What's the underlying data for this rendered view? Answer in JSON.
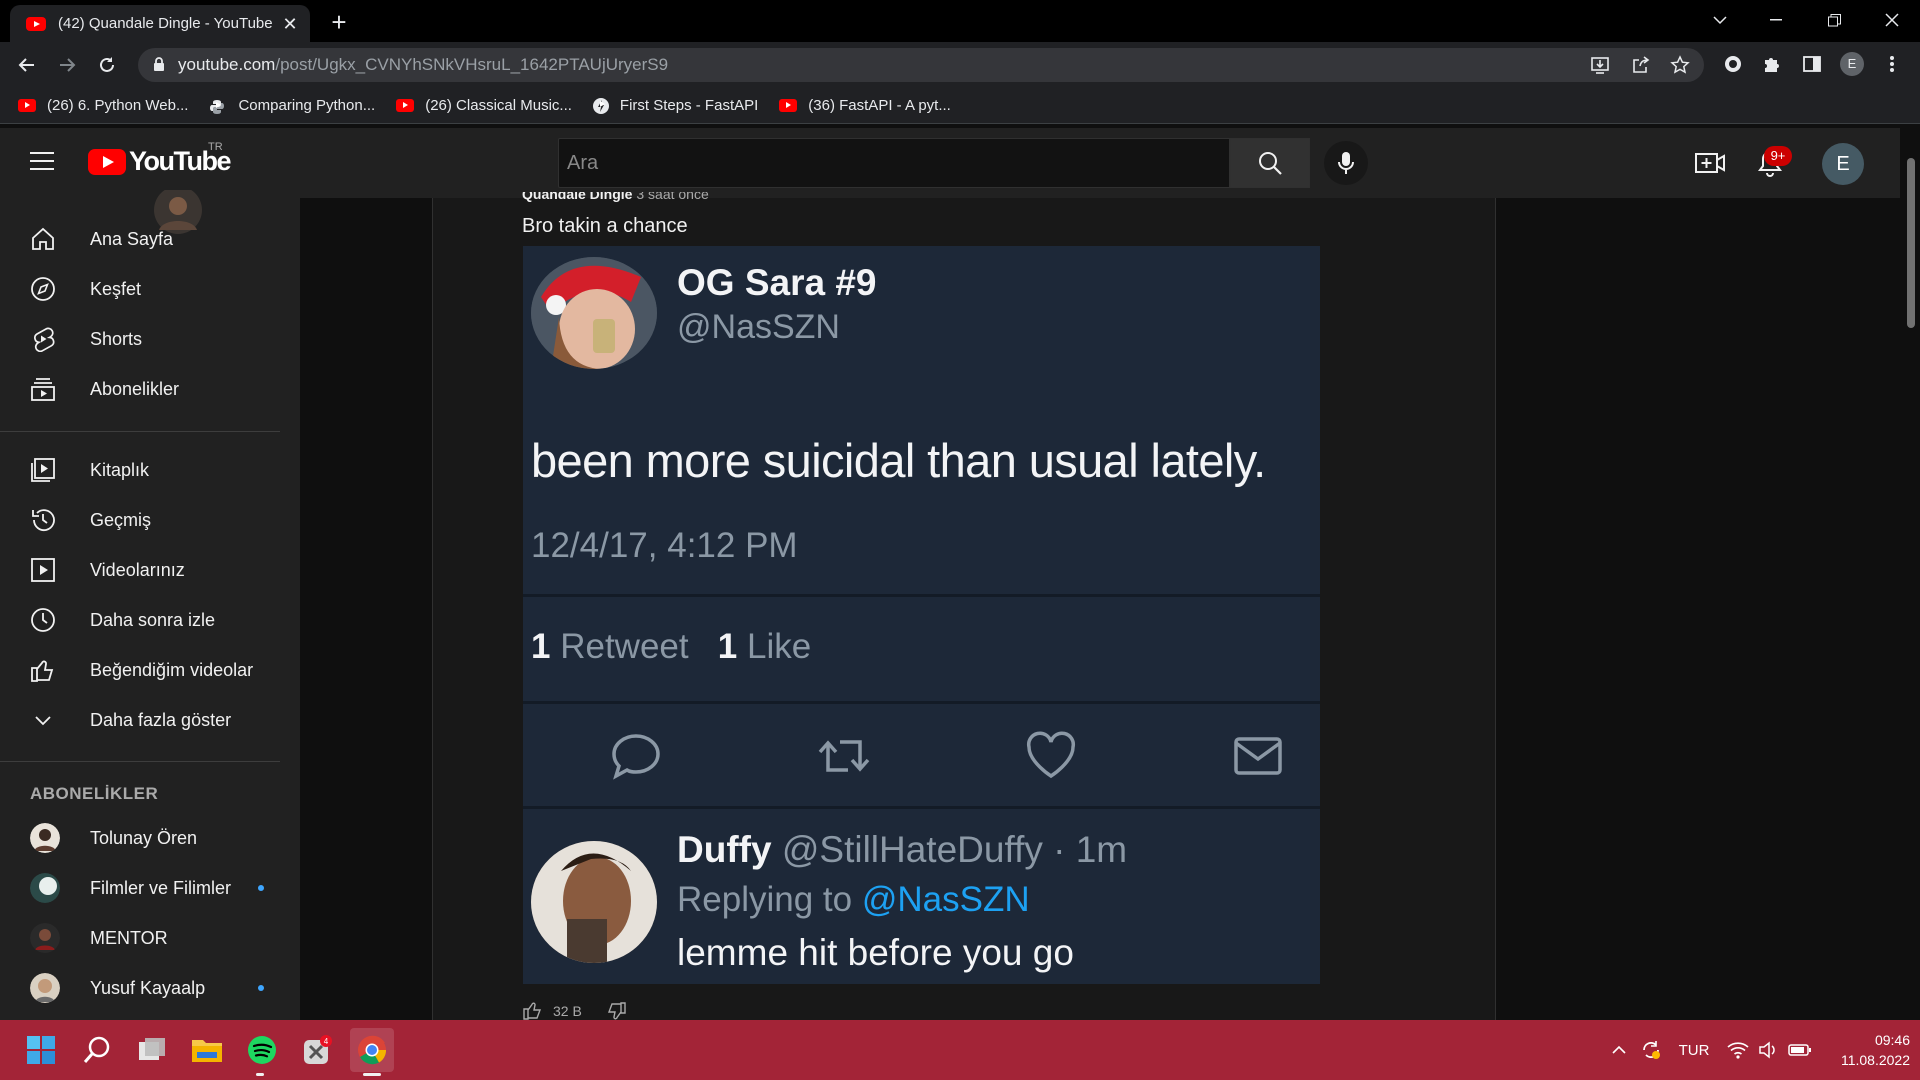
{
  "browser": {
    "tab_title": "(42) Quandale Dingle - YouTube",
    "url_host": "youtube.com",
    "url_path": "/post/Ugkx_CVNYhSNkVHsruL_1642PTAUjUryerS9",
    "profile_initial": "E",
    "bookmarks": [
      {
        "label": "(26) 6. Python Web...",
        "icon": "youtube-icon"
      },
      {
        "label": "Comparing Python...",
        "icon": "python-icon"
      },
      {
        "label": "(26) Classical Music...",
        "icon": "youtube-icon"
      },
      {
        "label": "First Steps - FastAPI",
        "icon": "fastapi-icon"
      },
      {
        "label": "(36) FastAPI - A pyt...",
        "icon": "youtube-icon"
      }
    ]
  },
  "youtube": {
    "logo_text": "YouTube",
    "region": "TR",
    "search_placeholder": "Ara",
    "notification_count": "9+",
    "avatar_initial": "E"
  },
  "sidebar": {
    "primary": [
      {
        "label": "Ana Sayfa",
        "icon": "home-icon"
      },
      {
        "label": "Keşfet",
        "icon": "explore-icon"
      },
      {
        "label": "Shorts",
        "icon": "shorts-icon"
      },
      {
        "label": "Abonelikler",
        "icon": "subscriptions-icon"
      }
    ],
    "library": [
      {
        "label": "Kitaplık",
        "icon": "library-icon"
      },
      {
        "label": "Geçmiş",
        "icon": "history-icon"
      },
      {
        "label": "Videolarınız",
        "icon": "your-videos-icon"
      },
      {
        "label": "Daha sonra izle",
        "icon": "watch-later-icon"
      },
      {
        "label": "Beğendiğim videolar",
        "icon": "liked-icon"
      },
      {
        "label": "Daha fazla göster",
        "icon": "chevron-down-icon"
      }
    ],
    "subscriptions_heading": "ABONELİKLER",
    "subscriptions": [
      {
        "label": "Tolunay Ören",
        "new": false
      },
      {
        "label": "Filmler ve Filimler",
        "new": true
      },
      {
        "label": "MENTOR",
        "new": false
      },
      {
        "label": "Yusuf Kayaalp",
        "new": true
      }
    ]
  },
  "post": {
    "author": "Quandale Dingle",
    "time": "3 saat önce",
    "text": "Bro takin a chance",
    "likes": "32 B",
    "tweet": {
      "name": "OG Sara #9",
      "handle": "@NasSZN",
      "body": "been more suicidal than usual lately.",
      "date": "12/4/17, 4:12 PM",
      "retweets_count": "1",
      "retweets_label": "Retweet",
      "likes_count": "1",
      "likes_label": "Like",
      "reply_name": "Duffy",
      "reply_handle_time": "@StillHateDuffy · 1m",
      "replying_to_label": "Replying to",
      "replying_to_handle": "@NasSZN",
      "reply_text": "lemme hit before you go"
    }
  },
  "taskbar": {
    "language": "TUR",
    "time": "09:46",
    "date": "11.08.2022"
  },
  "colors": {
    "youtube_red": "#ff0000",
    "taskbar": "#a32437",
    "twitter_blue": "#1da1f2",
    "tweet_bg": "#1d2838"
  }
}
